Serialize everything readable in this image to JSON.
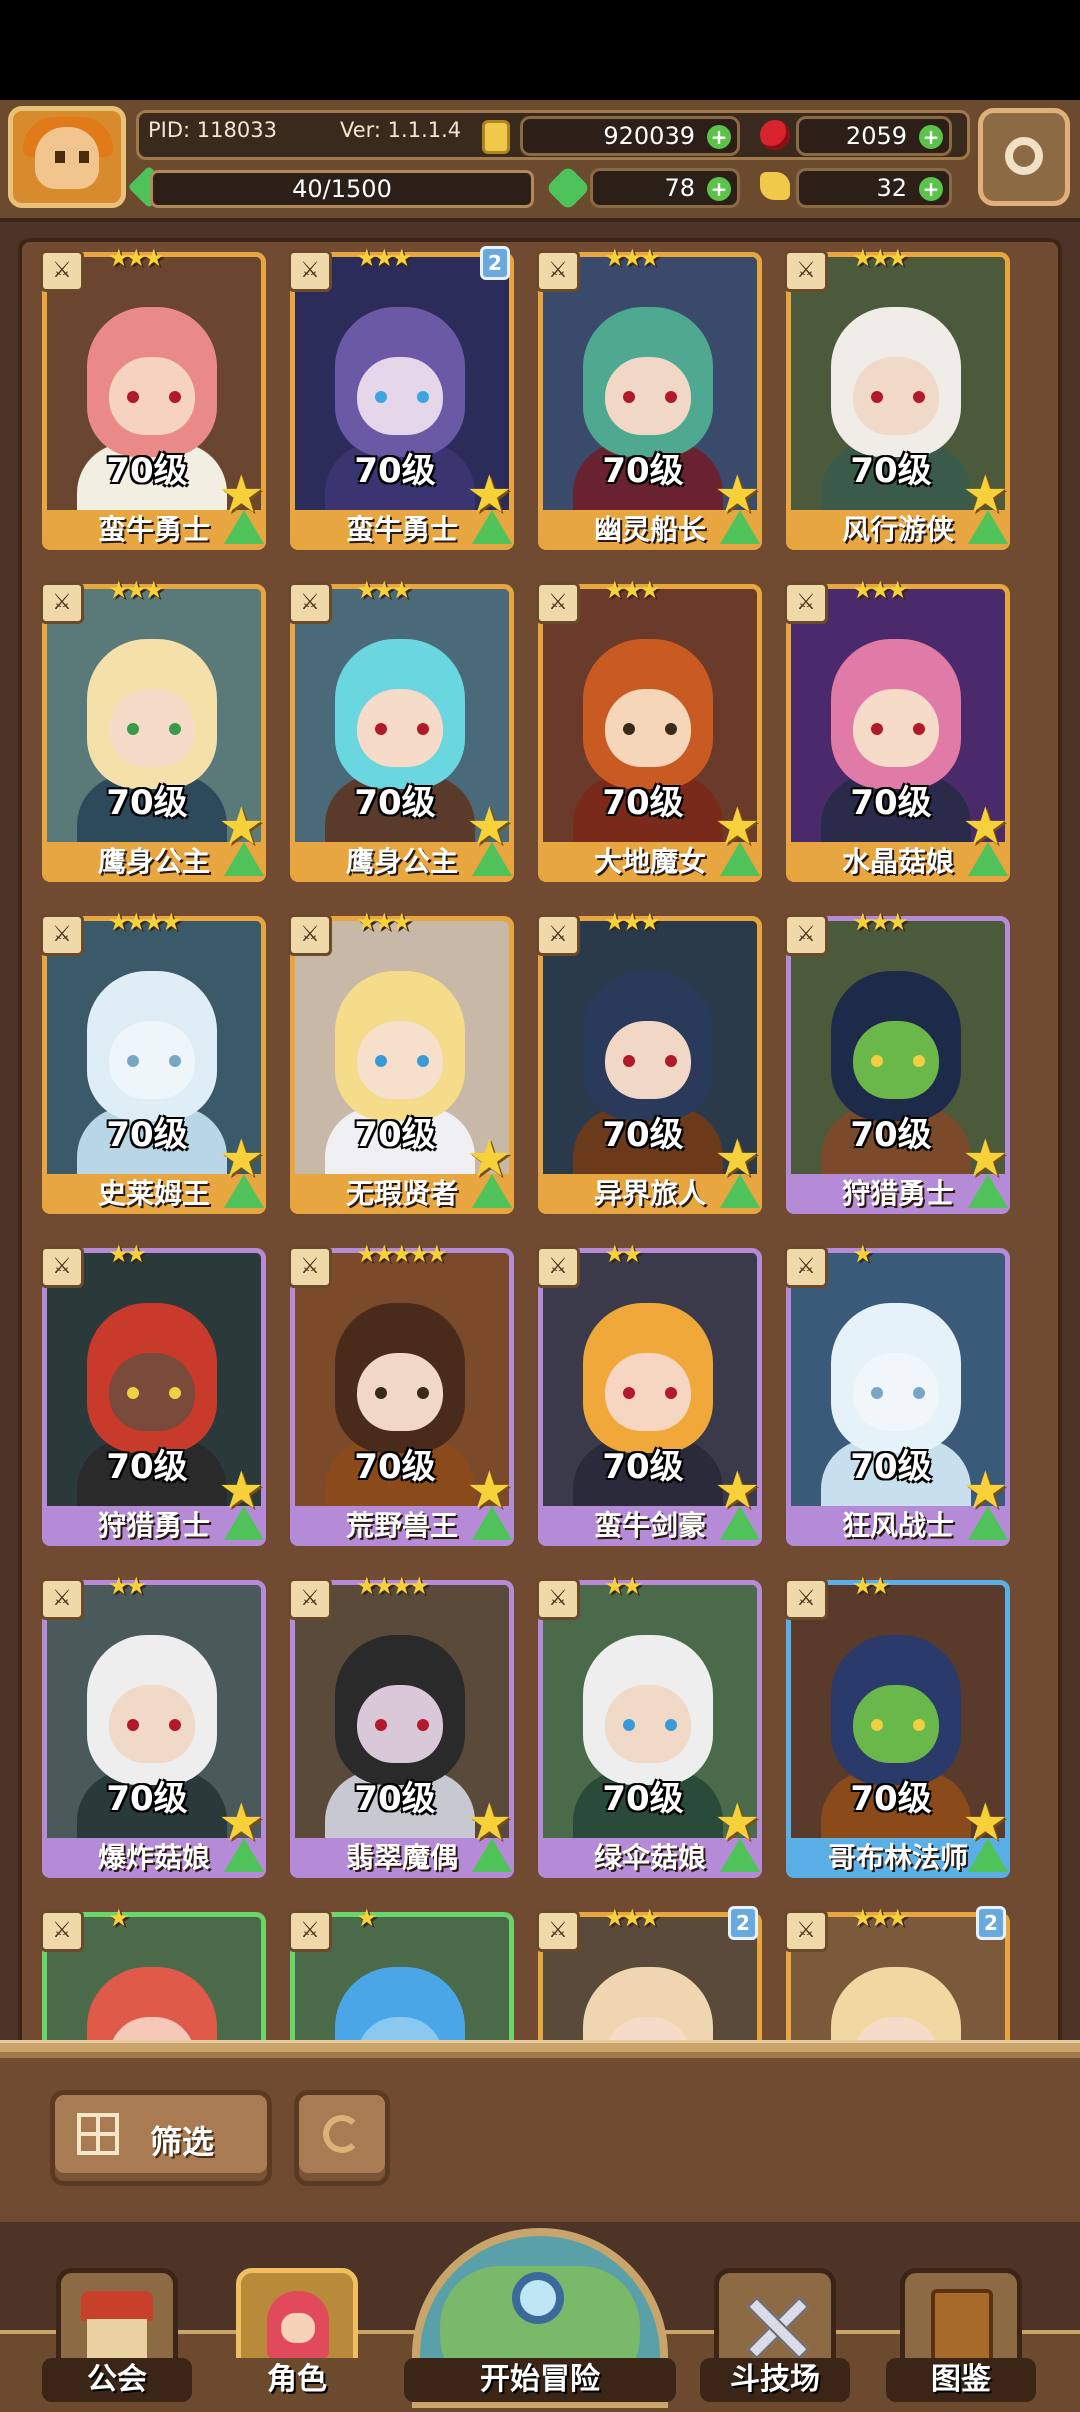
{
  "header": {
    "pid": "PID: 118033",
    "version": "Ver: 1.1.1.4",
    "gold": "920039",
    "ruby": "2059",
    "clover": "78",
    "keys": "32",
    "xp": "40/1500"
  },
  "cards": [
    {
      "level": "70级",
      "name": "蛮牛勇士",
      "stars": "★★★",
      "badge": "",
      "frame": "#e7a640",
      "hair": "#e98a86",
      "body": "#f3eee2",
      "bg": "#6a4630",
      "skin": "#f6d3c0",
      "eye": "#b01a2a"
    },
    {
      "level": "70级",
      "name": "蛮牛勇士",
      "stars": "★★★",
      "badge": "2",
      "frame": "#e7a640",
      "hair": "#6a5aa6",
      "body": "#3a3570",
      "bg": "#2c2c5a",
      "skin": "#e6d6ea",
      "eye": "#3aa6e0"
    },
    {
      "level": "70级",
      "name": "幽灵船长",
      "stars": "★★★",
      "badge": "",
      "frame": "#e7a640",
      "hair": "#4fa890",
      "body": "#6a2230",
      "bg": "#3a4a6a",
      "skin": "#f1d7c6",
      "eye": "#b01a2a"
    },
    {
      "level": "70级",
      "name": "风行游侠",
      "stars": "★★★",
      "badge": "",
      "frame": "#e7a640",
      "hair": "#f0ece8",
      "body": "#3a5a4a",
      "bg": "#4a5a3a",
      "skin": "#f1d9c8",
      "eye": "#b01a2a"
    },
    {
      "level": "70级",
      "name": "鹰身公主",
      "stars": "★★★",
      "badge": "",
      "frame": "#e7a640",
      "hair": "#f4e0a8",
      "body": "#2c4a5a",
      "bg": "#5a7a7a",
      "skin": "#f6dcc8",
      "eye": "#3a9a4a"
    },
    {
      "level": "70级",
      "name": "鹰身公主",
      "stars": "★★★",
      "badge": "",
      "frame": "#e7a640",
      "hair": "#6ad6e0",
      "body": "#5a3a2a",
      "bg": "#4a6a7a",
      "skin": "#f6dcc8",
      "eye": "#b01a2a"
    },
    {
      "level": "70级",
      "name": "大地魔女",
      "stars": "★★★",
      "badge": "",
      "frame": "#e7a640",
      "hair": "#c85a22",
      "body": "#7a2a1a",
      "bg": "#6a3a2a",
      "skin": "#f6d6b8",
      "eye": "#3a2a1a"
    },
    {
      "level": "70级",
      "name": "水晶菇娘",
      "stars": "★★★",
      "badge": "",
      "frame": "#e7a640",
      "hair": "#e07aa6",
      "body": "#2a2a4a",
      "bg": "#4a2a6a",
      "skin": "#f6dcc8",
      "eye": "#b01a2a"
    },
    {
      "level": "70级",
      "name": "史莱姆王",
      "stars": "★★★★",
      "badge": "",
      "frame": "#e7a640",
      "hair": "#dfeef6",
      "body": "#b8d6e6",
      "bg": "#3a5a6a",
      "skin": "#eef6fa",
      "eye": "#7aa6c6"
    },
    {
      "level": "70级",
      "name": "无瑕贤者",
      "stars": "★★★",
      "badge": "",
      "frame": "#e7a640",
      "hair": "#f4dc8a",
      "body": "#f0f0f4",
      "bg": "#c8b8a8",
      "skin": "#f6e0cc",
      "eye": "#3a9ad6"
    },
    {
      "level": "70级",
      "name": "异界旅人",
      "stars": "★★★",
      "badge": "",
      "frame": "#e7a640",
      "hair": "#2a3a5a",
      "body": "#6a3a1a",
      "bg": "#2a3a4a",
      "skin": "#f1d7c6",
      "eye": "#b01a2a"
    },
    {
      "level": "70级",
      "name": "狩猎勇士",
      "stars": "★★★",
      "badge": "",
      "frame": "#b58ad6",
      "hair": "#1e2a4a",
      "body": "#7a4a2a",
      "bg": "#4a5a3a",
      "skin": "#6ab84a",
      "eye": "#f0d040"
    },
    {
      "level": "70级",
      "name": "狩猎勇士",
      "stars": "★★",
      "badge": "",
      "frame": "#b58ad6",
      "hair": "#c83a2a",
      "body": "#2a2a2a",
      "bg": "#2a3a3a",
      "skin": "#7a4a3a",
      "eye": "#f0d040"
    },
    {
      "level": "70级",
      "name": "荒野兽王",
      "stars": "★★★★★",
      "badge": "",
      "frame": "#b58ad6",
      "hair": "#4a2a1a",
      "body": "#8a4a1a",
      "bg": "#7a4a2a",
      "skin": "#f1d7c6",
      "eye": "#3a2a1a"
    },
    {
      "level": "70级",
      "name": "蛮牛剑豪",
      "stars": "★★",
      "badge": "",
      "frame": "#b58ad6",
      "hair": "#f0a83a",
      "body": "#2a2a3a",
      "bg": "#3a3a4a",
      "skin": "#f6d6c0",
      "eye": "#b01a2a"
    },
    {
      "level": "70级",
      "name": "狂风战士",
      "stars": "★",
      "badge": "",
      "frame": "#b58ad6",
      "hair": "#e6f2fa",
      "body": "#c8e0ee",
      "bg": "#3a5a7a",
      "skin": "#f0f6fa",
      "eye": "#7aa6c6"
    },
    {
      "level": "70级",
      "name": "爆炸菇娘",
      "stars": "★★",
      "badge": "",
      "frame": "#b58ad6",
      "hair": "#eeeeee",
      "body": "#2a3a3a",
      "bg": "#4a5a5a",
      "skin": "#f1d9c8",
      "eye": "#b01a2a"
    },
    {
      "level": "70级",
      "name": "翡翠魔偶",
      "stars": "★★★★",
      "badge": "",
      "frame": "#b58ad6",
      "hair": "#2a2a2a",
      "body": "#c8c8d0",
      "bg": "#5a4a3a",
      "skin": "#d8c8d8",
      "eye": "#b01a2a"
    },
    {
      "level": "70级",
      "name": "绿伞菇娘",
      "stars": "★★",
      "badge": "",
      "frame": "#b58ad6",
      "hair": "#eeeeee",
      "body": "#2a4a3a",
      "bg": "#4a6a4a",
      "skin": "#f1d9c8",
      "eye": "#3a9ad6"
    },
    {
      "level": "70级",
      "name": "哥布林法师",
      "stars": "★★",
      "badge": "",
      "frame": "#5ab0e6",
      "hair": "#2a3a6a",
      "body": "#8a4a1a",
      "bg": "#5a3a2a",
      "skin": "#6ab84a",
      "eye": "#f0d040"
    },
    {
      "level": "",
      "name": "",
      "stars": "★",
      "badge": "",
      "frame": "#6ad66a",
      "hair": "#e05a4a",
      "body": "#c83a2a",
      "bg": "#4a6a4a",
      "skin": "#f6c8b8",
      "eye": "#b01a2a"
    },
    {
      "level": "",
      "name": "",
      "stars": "★",
      "badge": "",
      "frame": "#6ad66a",
      "hair": "#4aa6e6",
      "body": "#2a6aa6",
      "bg": "#4a6a4a",
      "skin": "#8ac8f0",
      "eye": "#1a3a6a"
    },
    {
      "level": "",
      "name": "",
      "stars": "★★★",
      "badge": "2",
      "frame": "#e7a640",
      "hair": "#f0d6b0",
      "body": "#8a6a4a",
      "bg": "#5a4a3a",
      "skin": "#f6dcc8",
      "eye": "#b01a2a"
    },
    {
      "level": "",
      "name": "",
      "stars": "★★★",
      "badge": "2",
      "frame": "#e7a640",
      "hair": "#f0d8a0",
      "body": "#c8a870",
      "bg": "#7a5a3a",
      "skin": "#f6dcc8",
      "eye": "#3a2a1a"
    }
  ],
  "bottom": {
    "filter_label": "筛选"
  },
  "nav": {
    "guild": "公会",
    "character": "角色",
    "adventure": "开始冒险",
    "arena": "斗技场",
    "codex": "图鉴"
  }
}
